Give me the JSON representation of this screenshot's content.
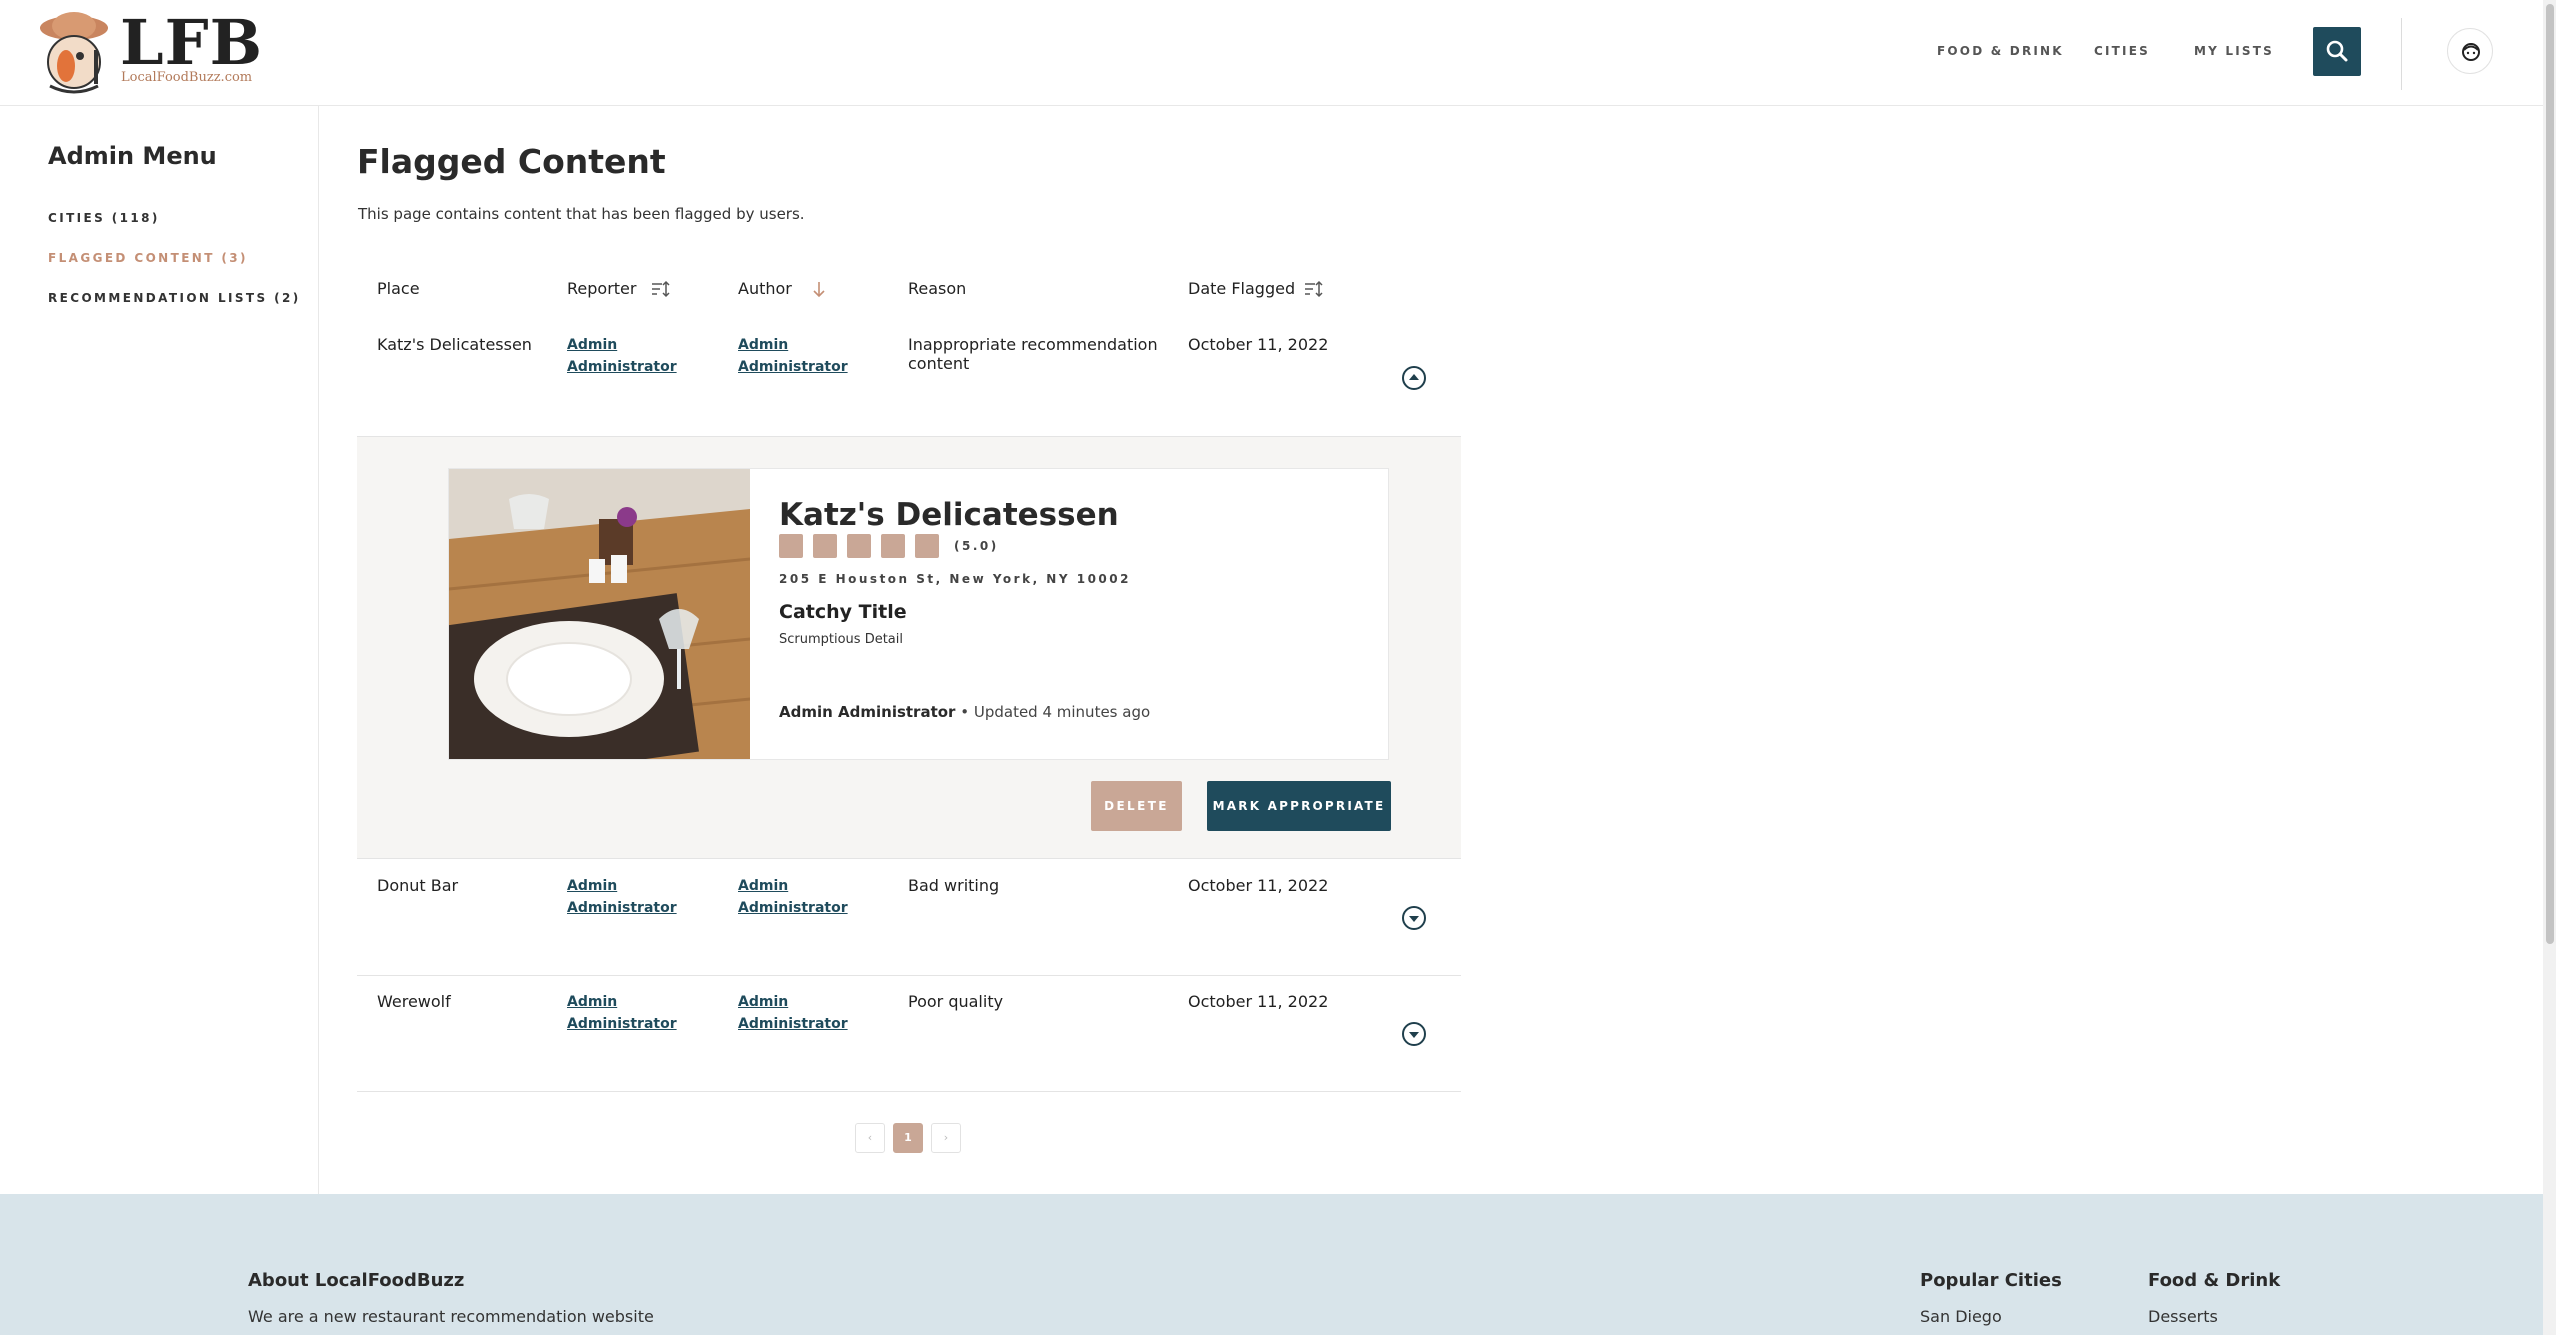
{
  "header": {
    "logo_text": "LFB",
    "logo_sub": "LocalFoodBuzz.com",
    "nav": [
      "FOOD & DRINK",
      "CITIES",
      "MY LISTS"
    ],
    "search_icon": "search-icon",
    "avatar_icon": "user-avatar-icon"
  },
  "sidebar": {
    "title": "Admin Menu",
    "items": [
      {
        "label": "CITIES (118)",
        "active": false
      },
      {
        "label": "FLAGGED CONTENT (3)",
        "active": true
      },
      {
        "label": "RECOMMENDATION LISTS (2)",
        "active": false
      }
    ]
  },
  "main": {
    "title": "Flagged Content",
    "description": "This page contains content that has been flagged by users.",
    "columns": [
      "Place",
      "Reporter",
      "Author",
      "Reason",
      "Date Flagged"
    ],
    "rows": [
      {
        "place": "Katz's Delicatessen",
        "reporter_1": "Admin",
        "reporter_2": "Administrator",
        "author_1": "Admin",
        "author_2": "Administrator",
        "reason": "Inappropriate recommendation content",
        "date": "October 11, 2022",
        "expanded": true
      },
      {
        "place": "Donut Bar",
        "reporter_1": "Admin",
        "reporter_2": "Administrator",
        "author_1": "Admin",
        "author_2": "Administrator",
        "reason": "Bad writing",
        "date": "October 11, 2022",
        "expanded": false
      },
      {
        "place": "Werewolf",
        "reporter_1": "Admin",
        "reporter_2": "Administrator",
        "author_1": "Admin",
        "author_2": "Administrator",
        "reason": "Poor quality",
        "date": "October 11, 2022",
        "expanded": false
      }
    ],
    "detail": {
      "name": "Katz's Delicatessen",
      "rating": 5,
      "rating_text": "(5.0)",
      "address": "205 E Houston St, New York, NY 10002",
      "rec_title": "Catchy Title",
      "rec_detail": "Scrumptious Detail",
      "author": "Admin Administrator",
      "updated": "• Updated 4 minutes ago",
      "delete_label": "DELETE",
      "approve_label": "MARK APPROPRIATE"
    },
    "pagination": {
      "prev": "‹",
      "current": "1",
      "next": "›"
    }
  },
  "footer": {
    "about_heading": "About LocalFoodBuzz",
    "about_text": "We are a new restaurant recommendation website",
    "cities_heading": "Popular Cities",
    "cities_first": "San Diego",
    "food_heading": "Food & Drink",
    "food_first": "Desserts"
  },
  "colors": {
    "accent": "#1f4b5c",
    "tan": "#c9a796",
    "footer_bg": "#d8e4ea"
  }
}
